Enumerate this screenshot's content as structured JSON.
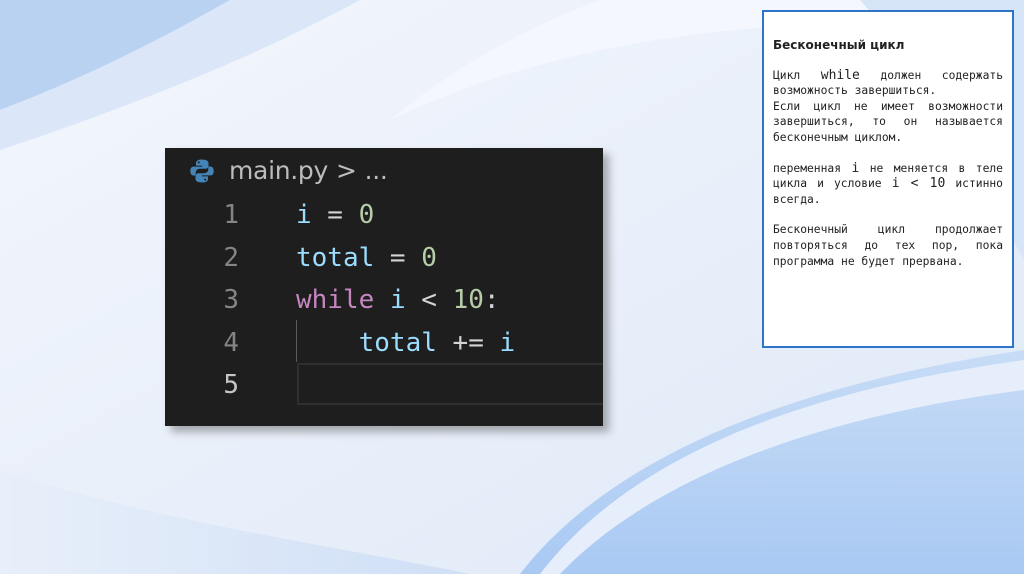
{
  "editor": {
    "file_name": "main.py",
    "breadcrumb_separator": ">",
    "breadcrumb_more": "...",
    "lines": [
      {
        "number": "1",
        "tokens": [
          [
            "var",
            "i"
          ],
          [
            "op",
            " = "
          ],
          [
            "num",
            "0"
          ]
        ]
      },
      {
        "number": "2",
        "tokens": [
          [
            "var",
            "total"
          ],
          [
            "op",
            " = "
          ],
          [
            "num",
            "0"
          ]
        ]
      },
      {
        "number": "3",
        "tokens": [
          [
            "kw",
            "while"
          ],
          [
            "op",
            " "
          ],
          [
            "var",
            "i"
          ],
          [
            "op",
            " < "
          ],
          [
            "num",
            "10"
          ],
          [
            "op",
            ":"
          ]
        ]
      },
      {
        "number": "4",
        "tokens": [
          [
            "op",
            "    "
          ],
          [
            "var",
            "total"
          ],
          [
            "op",
            " += "
          ],
          [
            "var",
            "i"
          ]
        ]
      },
      {
        "number": "5",
        "tokens": []
      }
    ],
    "active_line": "5"
  },
  "note": {
    "title": "Бесконечный цикл",
    "para1_a": "Цикл ",
    "para1_code": "while",
    "para1_b": " должен содержать возможность завершиться.",
    "para2": "Если цикл не имеет возможности завершиться, то он называется бесконечным циклом.",
    "para3_a": "переменная ",
    "para3_code1": "i",
    "para3_b": " не меняется в теле цикла и условие ",
    "para3_code2": "i < 10",
    "para3_c": " истинно всегда.",
    "para4": "Бесконечный цикл продолжает повторяться до тех пор, пока программа не будет прервана."
  },
  "colors": {
    "editor_bg": "#1e1e1e",
    "variable": "#9cdcfe",
    "number": "#b5cea8",
    "keyword": "#c586c0",
    "note_border": "#2e74c9"
  },
  "icons": {
    "file_icon": "python-icon"
  }
}
